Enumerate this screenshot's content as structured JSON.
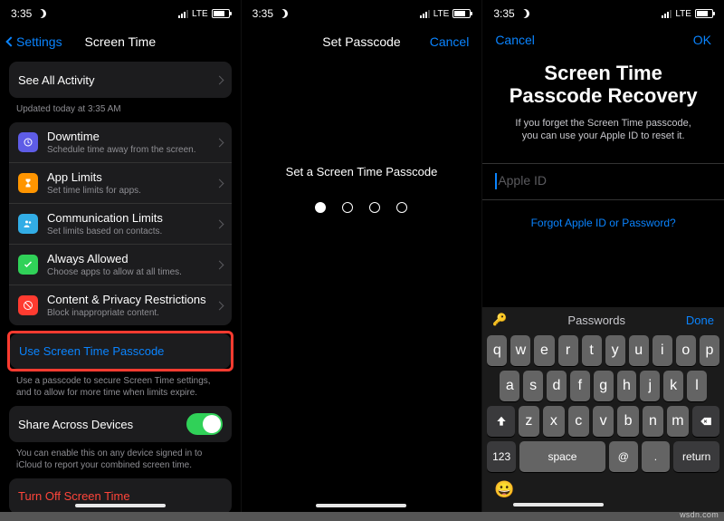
{
  "status": {
    "time": "3:35",
    "lte": "LTE"
  },
  "panel1": {
    "back": "Settings",
    "title": "Screen Time",
    "seeAll": "See All Activity",
    "updated": "Updated today at 3:35 AM",
    "items": [
      {
        "title": "Downtime",
        "sub": "Schedule time away from the screen."
      },
      {
        "title": "App Limits",
        "sub": "Set time limits for apps."
      },
      {
        "title": "Communication Limits",
        "sub": "Set limits based on contacts."
      },
      {
        "title": "Always Allowed",
        "sub": "Choose apps to allow at all times."
      },
      {
        "title": "Content & Privacy Restrictions",
        "sub": "Block inappropriate content."
      }
    ],
    "usePasscode": "Use Screen Time Passcode",
    "passcodeCaption": "Use a passcode to secure Screen Time settings, and to allow for more time when limits expire.",
    "share": "Share Across Devices",
    "shareCaption": "You can enable this on any device signed in to iCloud to report your combined screen time.",
    "turnOff": "Turn Off Screen Time"
  },
  "panel2": {
    "title": "Set Passcode",
    "cancel": "Cancel",
    "label": "Set a Screen Time Passcode"
  },
  "panel3": {
    "cancel": "Cancel",
    "ok": "OK",
    "heading": "Screen Time Passcode Recovery",
    "body": "If you forget the Screen Time passcode, you can use your Apple ID to reset it.",
    "placeholder": "Apple ID",
    "forgot": "Forgot Apple ID or Password?",
    "passwords": "Passwords",
    "done": "Done",
    "rows": {
      "r1": [
        "q",
        "w",
        "e",
        "r",
        "t",
        "y",
        "u",
        "i",
        "o",
        "p"
      ],
      "r2": [
        "a",
        "s",
        "d",
        "f",
        "g",
        "h",
        "j",
        "k",
        "l"
      ],
      "r3": [
        "z",
        "x",
        "c",
        "v",
        "b",
        "n",
        "m"
      ]
    },
    "numKey": "123",
    "space": "space",
    "at": "@",
    "dot": ".",
    "return": "return"
  },
  "watermark": "wsdn.com"
}
